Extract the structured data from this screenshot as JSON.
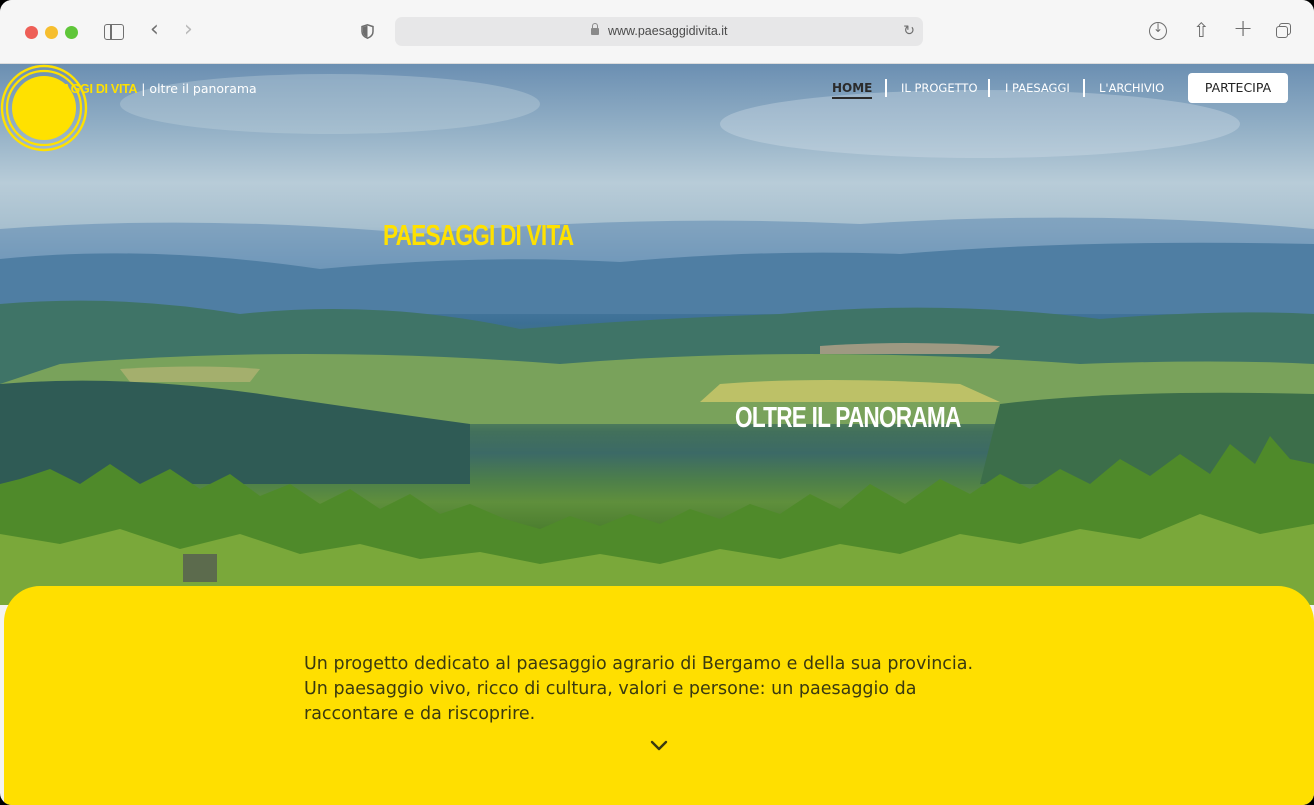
{
  "browser": {
    "url": "www.paesaggidivita.it"
  },
  "site": {
    "brand_name": "PAESAGGI DI VITA",
    "brand_tagline": "| oltre il panorama",
    "nav": [
      {
        "label": "HOME",
        "active": true
      },
      {
        "label": "IL PROGETTO",
        "active": false
      },
      {
        "label": "I PAESAGGI",
        "active": false
      },
      {
        "label": "L'ARCHIVIO",
        "active": false
      }
    ],
    "cta_label": "PARTECIPA"
  },
  "hero": {
    "title": "PAESAGGI DI VITA",
    "subtitle": "OLTRE IL PANORAMA"
  },
  "intro": {
    "lines": [
      "Un progetto dedicato al paesaggio agrario di Bergamo e della sua provincia.",
      "Un paesaggio vivo, ricco di cultura, valori e persone: un paesaggio da",
      "raccontare e da riscoprire."
    ]
  },
  "colors": {
    "accent_yellow": "#ffe100",
    "panel_yellow": "#ffdf00"
  }
}
